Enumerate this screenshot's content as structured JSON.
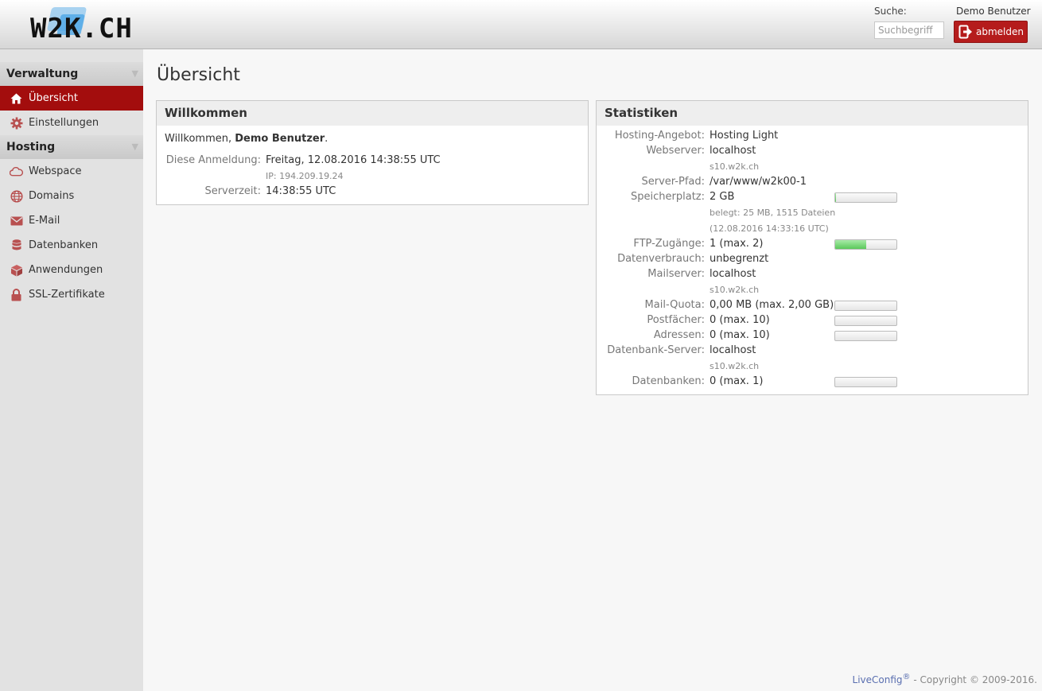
{
  "header": {
    "logo_text": "W2K.CH",
    "search_label": "Suche:",
    "search_placeholder": "Suchbegriff",
    "user_name": "Demo Benutzer",
    "logout_label": "abmelden"
  },
  "sidebar": {
    "sections": [
      {
        "label": "Verwaltung"
      },
      {
        "label": "Hosting"
      }
    ],
    "items": [
      {
        "label": "Übersicht",
        "icon": "home-icon"
      },
      {
        "label": "Einstellungen",
        "icon": "gear-icon"
      },
      {
        "label": "Webspace",
        "icon": "cloud-icon"
      },
      {
        "label": "Domains",
        "icon": "globe-icon"
      },
      {
        "label": "E-Mail",
        "icon": "envelope-icon"
      },
      {
        "label": "Datenbanken",
        "icon": "database-icon"
      },
      {
        "label": "Anwendungen",
        "icon": "package-icon"
      },
      {
        "label": "SSL-Zertifikate",
        "icon": "lock-icon"
      }
    ]
  },
  "main": {
    "title": "Übersicht",
    "welcome": {
      "title": "Willkommen",
      "greeting_prefix": "Willkommen,",
      "greeting_name": "Demo Benutzer",
      "greeting_suffix": ".",
      "login_label": "Diese Anmeldung:",
      "login_value": "Freitag, 12.08.2016 14:38:55 UTC",
      "login_ip": "IP: 194.209.19.24",
      "servertime_label": "Serverzeit:",
      "servertime_value": "14:38:55 UTC"
    },
    "stats": {
      "title": "Statistiken",
      "rows": [
        {
          "key": "Hosting-Angebot:",
          "value": "Hosting Light"
        },
        {
          "key": "Webserver:",
          "value": "localhost",
          "sub": "s10.w2k.ch"
        },
        {
          "key": "Server-Pfad:",
          "value": "/var/www/w2k00-1"
        },
        {
          "key": "Speicherplatz:",
          "value": "2 GB",
          "sub": "belegt: 25 MB, 1515 Dateien",
          "sub2": "(12.08.2016 14:33:16 UTC)",
          "usage": 0.01
        },
        {
          "key": "FTP-Zugänge:",
          "value": "1 (max. 2)",
          "usage": 0.5
        },
        {
          "key": "Datenverbrauch:",
          "value": "unbegrenzt"
        },
        {
          "key": "Mailserver:",
          "value": "localhost",
          "sub": "s10.w2k.ch"
        },
        {
          "key": "Mail-Quota:",
          "value": "0,00 MB (max. 2,00 GB)",
          "usage": 0
        },
        {
          "key": "Postfächer:",
          "value": "0 (max. 10)",
          "usage": 0
        },
        {
          "key": "Adressen:",
          "value": "0 (max. 10)",
          "usage": 0
        },
        {
          "key": "Datenbank-Server:",
          "value": "localhost",
          "sub": "s10.w2k.ch"
        },
        {
          "key": "Datenbanken:",
          "value": "0 (max. 1)",
          "usage": 0
        }
      ]
    }
  },
  "footer": {
    "brand": "LiveConfig",
    "brand_mark": "®",
    "copyright": " - Copyright © 2009-2016."
  },
  "colors": {
    "accent": "#a30d0d",
    "logout_bg": "#b51c1c",
    "bar_fill": "#5ac85a",
    "logo_blue": "#4da6e6"
  }
}
